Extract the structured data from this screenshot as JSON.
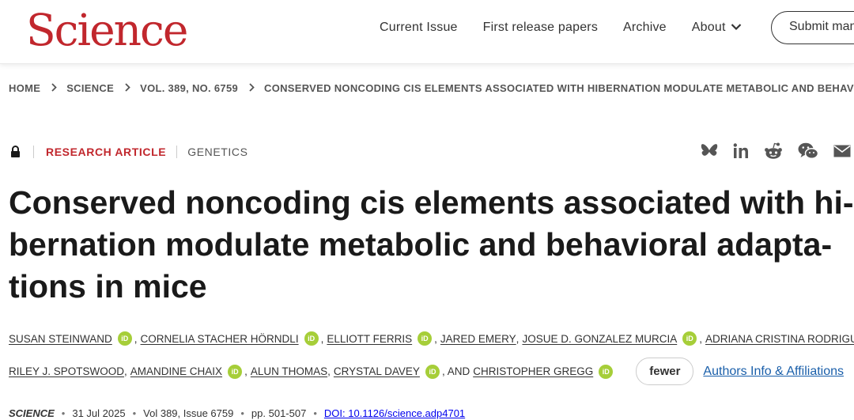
{
  "header": {
    "logo": "Science",
    "nav": [
      "Current Issue",
      "First release papers",
      "Archive",
      "About"
    ],
    "submit_label": "Submit manuscript"
  },
  "breadcrumb": [
    "HOME",
    "SCIENCE",
    "VOL. 389, NO. 6759",
    "CONSERVED NONCODING CIS ELEMENTS ASSOCIATED WITH HIBERNATION MODULATE METABOLIC AND BEHAVIORA..."
  ],
  "article": {
    "type": "RESEARCH ARTICLE",
    "section": "GENETICS",
    "title_lines": [
      "Conserved noncoding cis elements associated with hi-",
      "bernation modulate metabolic and behavioral adapta-",
      "tions in mice"
    ]
  },
  "authors": {
    "line1": [
      {
        "name": "SUSAN STEINWAND",
        "orcid": true,
        "suffix": ","
      },
      {
        "name": "CORNELIA STACHER HÖRNDLI",
        "orcid": true,
        "suffix": ","
      },
      {
        "name": "ELLIOTT FERRIS",
        "orcid": true,
        "suffix": ","
      },
      {
        "name": "JARED EMERY",
        "orcid": false,
        "suffix": ","
      },
      {
        "name": "JOSUE D. GONZALEZ MURCIA",
        "orcid": true,
        "suffix": ","
      },
      {
        "name": "ADRIANA CRISTINA RODRIGUEZ",
        "orcid": true,
        "suffix": ","
      }
    ],
    "line2": [
      {
        "name": "RILEY J. SPOTSWOOD",
        "orcid": false,
        "suffix": ","
      },
      {
        "name": "AMANDINE CHAIX",
        "orcid": true,
        "suffix": ","
      },
      {
        "name": "ALUN THOMAS",
        "orcid": false,
        "suffix": ","
      },
      {
        "name": "CRYSTAL DAVEY",
        "orcid": true,
        "suffix": ", AND"
      },
      {
        "name": "CHRISTOPHER GREGG",
        "orcid": true,
        "suffix": ""
      }
    ],
    "fewer_label": "fewer",
    "affiliations_label": "Authors Info & Affiliations"
  },
  "citation": {
    "journal": "SCIENCE",
    "date": "31 Jul 2025",
    "volume": "Vol 389, Issue 6759",
    "pages": "pp. 501-507",
    "doi": "DOI: 10.1126/science.adp4701"
  },
  "orcid_label": "iD",
  "colors": {
    "brand": "#c1272d",
    "orcid": "#a6ce39",
    "link": "#1a5faa"
  },
  "share_icons": [
    "bluesky-icon",
    "linkedin-icon",
    "reddit-icon",
    "wechat-icon",
    "email-icon"
  ]
}
